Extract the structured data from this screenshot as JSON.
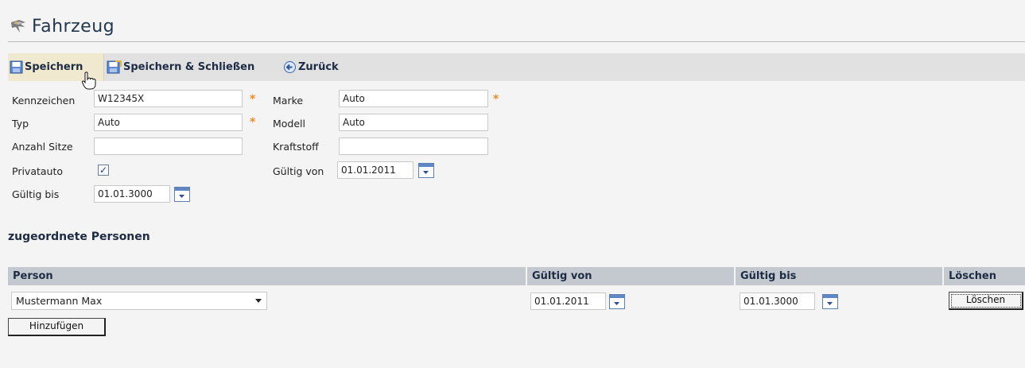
{
  "page": {
    "title": "Fahrzeug"
  },
  "toolbar": {
    "save_label": "Speichern",
    "save_close_label": "Speichern & Schließen",
    "back_label": "Zurück"
  },
  "form": {
    "kennzeichen": {
      "label": "Kennzeichen",
      "value": "W12345X",
      "required": true
    },
    "marke": {
      "label": "Marke",
      "value": "Auto",
      "required": true
    },
    "typ": {
      "label": "Typ",
      "value": "Auto",
      "required": true
    },
    "modell": {
      "label": "Modell",
      "value": "Auto"
    },
    "anzahl_sitze": {
      "label": "Anzahl Sitze",
      "value": ""
    },
    "kraftstoff": {
      "label": "Kraftstoff",
      "value": ""
    },
    "privatauto": {
      "label": "Privatauto",
      "checked": true
    },
    "gueltig_von": {
      "label": "Gültig von",
      "value": "01.01.2011"
    },
    "gueltig_bis": {
      "label": "Gültig bis",
      "value": "01.01.3000"
    },
    "required_marker": "*"
  },
  "persons": {
    "title": "zugeordnete Personen",
    "columns": [
      "Person",
      "Gültig von",
      "Gültig bis",
      "Löschen"
    ],
    "rows": [
      {
        "person": "Mustermann Max",
        "gueltig_von": "01.01.2011",
        "gueltig_bis": "01.01.3000",
        "delete_label": "Löschen"
      }
    ],
    "add_label": "Hinzufügen"
  },
  "colors": {
    "toolbar_bg": "#e1e1e1",
    "header_bg": "#c4c9d0",
    "accent": "#f08a24",
    "title": "#23374f"
  },
  "icons": {
    "title": "bird-logo-icon",
    "save": "save-icon",
    "save_close": "save-close-icon",
    "back": "back-arrow-icon",
    "calendar": "calendar-icon"
  }
}
